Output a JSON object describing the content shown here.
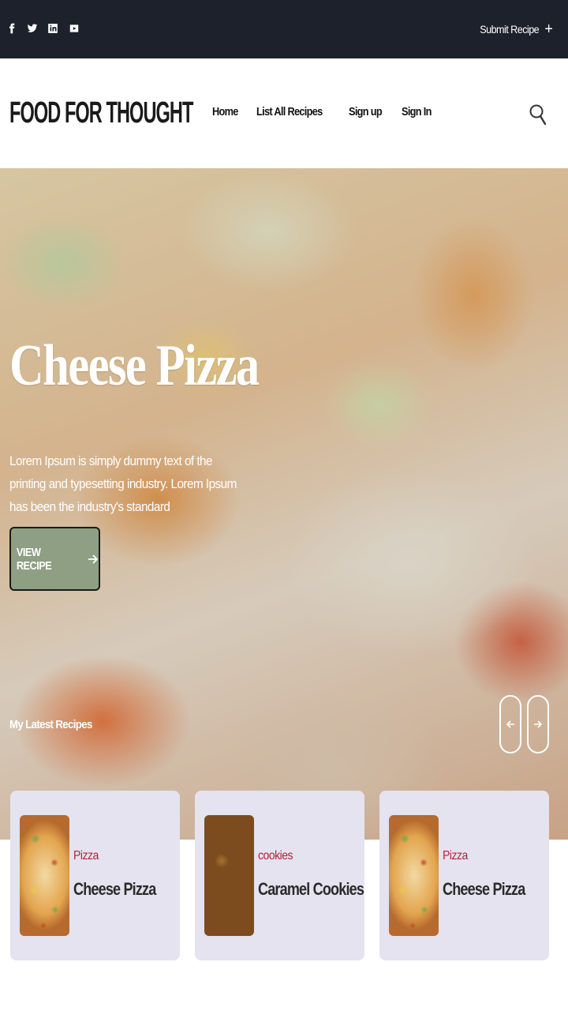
{
  "topbar": {
    "social_icons": [
      "facebook-icon",
      "twitter-icon",
      "linkedin-icon",
      "youtube-icon"
    ],
    "submit_label": "Submit Recipe",
    "submit_icon": "+"
  },
  "header": {
    "logo": "FOOD FOR THOUGHT",
    "nav": [
      "Home",
      "List All Recipes",
      "Sign up",
      "Sign In"
    ],
    "search_icon": "search-icon"
  },
  "hero": {
    "title": "Cheese Pizza",
    "description": "Lorem Ipsum is simply dummy text of the printing and typesetting industry. Lorem Ipsum has been the industry's standard",
    "button_label": "VIEW RECIPE",
    "button_color": "#8e9f83",
    "latest_heading": "My Latest Recipes"
  },
  "cards": [
    {
      "category": "Pizza",
      "name": "Cheese Pizza",
      "image": "pizza"
    },
    {
      "category": "cookies",
      "name": "Caramel Cookies",
      "image": "cookies"
    },
    {
      "category": "Pizza",
      "name": "Cheese Pizza",
      "image": "pizza"
    }
  ],
  "colors": {
    "topbar_bg": "#1c212b",
    "card_bg": "#e4e3ef",
    "category_text": "#b3233a"
  }
}
